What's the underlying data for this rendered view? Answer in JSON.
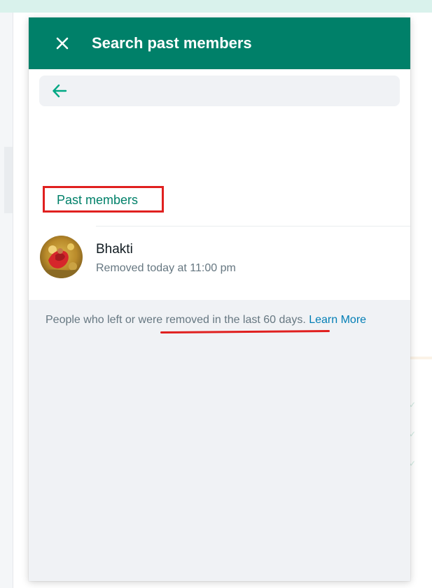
{
  "dialog": {
    "title": "Search past members",
    "close_icon": "close-icon",
    "back_icon": "arrow-left-icon",
    "search": {
      "value": "",
      "placeholder": ""
    }
  },
  "section": {
    "label": "Past members"
  },
  "members": [
    {
      "name": "Bhakti",
      "status": "Removed today at 11:00 pm",
      "avatar_icon": "avatar"
    }
  ],
  "footer": {
    "note": "People who left or were removed in the last 60 days.",
    "learn_more": "Learn More"
  },
  "colors": {
    "header": "#008069",
    "accent": "#008069",
    "link": "#027eb5",
    "annotation": "#e0201f"
  }
}
